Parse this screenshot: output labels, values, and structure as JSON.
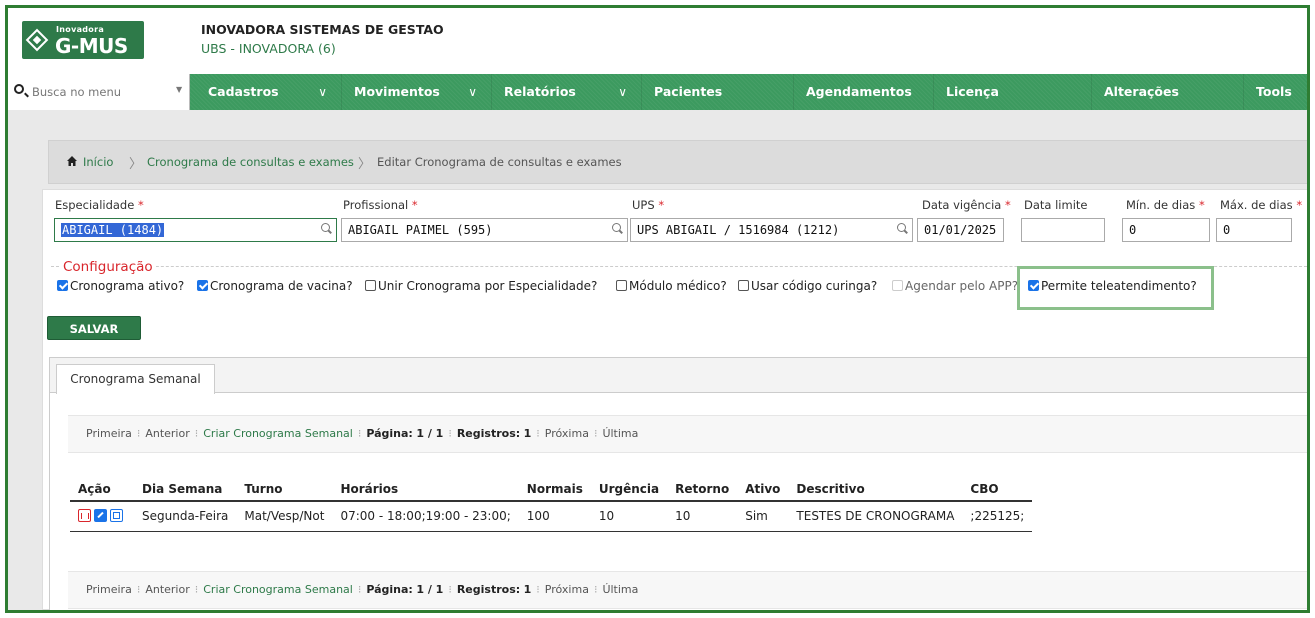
{
  "header": {
    "logo_small": "Inovadora",
    "logo_big": "G-MUS",
    "company": "INOVADORA SISTEMAS DE GESTAO",
    "unit": "UBS - INOVADORA (6)"
  },
  "menu": {
    "search_placeholder": "Busca no menu",
    "items": [
      {
        "label": "Cadastros",
        "caret": "∨"
      },
      {
        "label": "Movimentos",
        "caret": "∨"
      },
      {
        "label": "Relatórios",
        "caret": "∨"
      },
      {
        "label": "Pacientes"
      },
      {
        "label": "Agendamentos"
      },
      {
        "label": "Licença"
      },
      {
        "label": "Alterações"
      },
      {
        "label": "Tools"
      }
    ]
  },
  "breadcrumb": {
    "home": "Início",
    "sep": "〉",
    "item1": "Cronograma de consultas e exames",
    "item2": "Editar Cronograma de consultas e exames"
  },
  "form": {
    "especialidade": {
      "label": "Especialidade",
      "value": "ABIGAIL (1484)"
    },
    "profissional": {
      "label": "Profissional",
      "value": "ABIGAIL PAIMEL (595)"
    },
    "ups": {
      "label": "UPS",
      "value": "UPS ABIGAIL / 1516984 (1212)"
    },
    "data_vigencia": {
      "label": "Data vigência",
      "value": "01/01/2025"
    },
    "data_limite": {
      "label": "Data limite",
      "value": ""
    },
    "min_dias": {
      "label": "Mín. de dias",
      "value": "0"
    },
    "max_dias": {
      "label": "Máx. de dias",
      "value": "0"
    },
    "required_mark": "*"
  },
  "config": {
    "legend": "Configuração",
    "options": [
      {
        "label": "Cronograma ativo?",
        "checked": true
      },
      {
        "label": "Cronograma de vacina?",
        "checked": true
      },
      {
        "label": "Unir Cronograma por Especialidade?",
        "checked": false
      },
      {
        "label": "Módulo médico?",
        "checked": false
      },
      {
        "label": "Usar código curinga?",
        "checked": false
      },
      {
        "label": "Agendar pelo APP?",
        "checked": false,
        "disabled": true
      },
      {
        "label": "Permite teleatendimento?",
        "checked": true
      }
    ],
    "highlight_color": "#8bc08b"
  },
  "save_label": "SALVAR",
  "tab_label": "Cronograma Semanal",
  "pager": {
    "first": "Primeira",
    "prev": "Anterior",
    "create": "Criar Cronograma Semanal",
    "page_label": "Página:",
    "page_value": "1 / 1",
    "records_label": "Registros:",
    "records_value": "1",
    "next": "Próxima",
    "last": "Última"
  },
  "table": {
    "headers": [
      "Ação",
      "Dia Semana",
      "Turno",
      "Horários",
      "Normais",
      "Urgência",
      "Retorno",
      "Ativo",
      "Descritivo",
      "CBO"
    ],
    "rows": [
      [
        "",
        "Segunda-Feira",
        "Mat/Vesp/Not",
        "07:00 - 18:00;19:00 - 23:00;",
        "100",
        "10",
        "10",
        "Sim",
        "TESTES DE CRONOGRAMA",
        ";225125;"
      ]
    ]
  },
  "colors": {
    "brand": "#2e7a49",
    "menu": "#3c9a5f",
    "frame": "#2e7d32",
    "required": "#d9262c"
  }
}
